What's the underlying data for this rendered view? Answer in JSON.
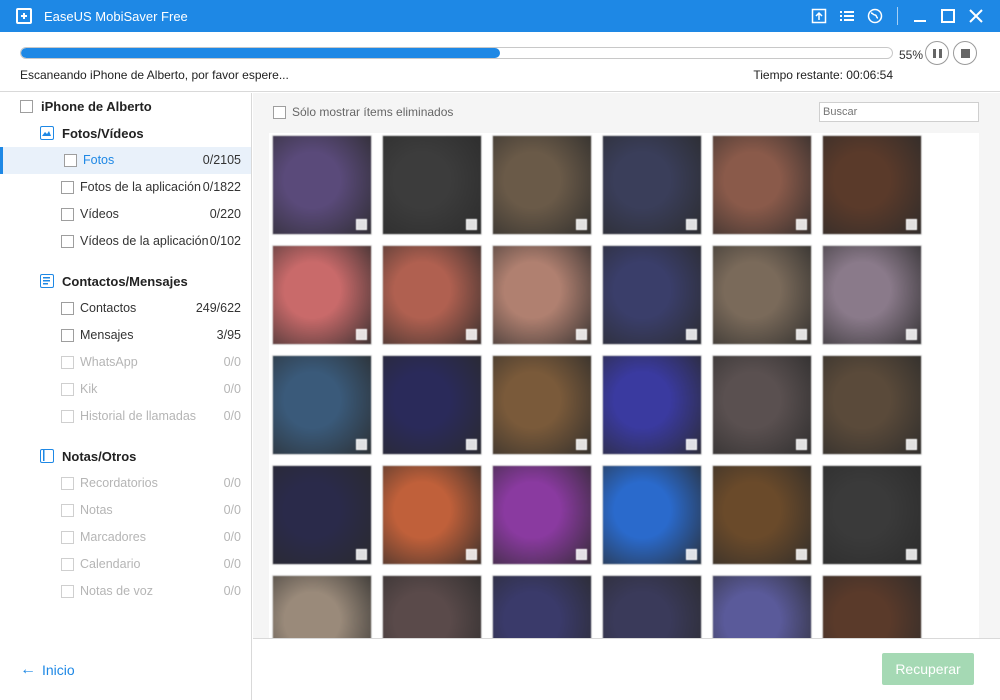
{
  "window": {
    "title": "EaseUS MobiSaver Free",
    "icons": [
      "upload-icon",
      "list-icon",
      "globe-icon",
      "minimize-icon",
      "maximize-icon",
      "close-icon"
    ]
  },
  "progress": {
    "percent_label": "55%",
    "percent": 55,
    "status": "Escaneando iPhone de Alberto, por favor espere...",
    "time_remaining": "Tiempo restante: 00:06:54"
  },
  "sidebar": {
    "device": "iPhone de Alberto",
    "categories": [
      {
        "label": "Fotos/Vídeos",
        "icon": "image-icon",
        "items": [
          {
            "label": "Fotos",
            "count": "0/2105",
            "state": "selected"
          },
          {
            "label": "Fotos de la aplicación",
            "count": "0/1822",
            "state": "normal"
          },
          {
            "label": "Vídeos",
            "count": "0/220",
            "state": "normal"
          },
          {
            "label": "Vídeos de la aplicación",
            "count": "0/102",
            "state": "normal"
          }
        ]
      },
      {
        "label": "Contactos/Mensajes",
        "icon": "contacts-icon",
        "items": [
          {
            "label": "Contactos",
            "count": "249/622",
            "state": "normal"
          },
          {
            "label": "Mensajes",
            "count": "3/95",
            "state": "normal"
          },
          {
            "label": "WhatsApp",
            "count": "0/0",
            "state": "disabled"
          },
          {
            "label": "Kik",
            "count": "0/0",
            "state": "disabled"
          },
          {
            "label": "Historial de llamadas",
            "count": "0/0",
            "state": "disabled"
          }
        ]
      },
      {
        "label": "Notas/Otros",
        "icon": "notes-icon",
        "items": [
          {
            "label": "Recordatorios",
            "count": "0/0",
            "state": "disabled"
          },
          {
            "label": "Notas",
            "count": "0/0",
            "state": "disabled"
          },
          {
            "label": "Marcadores",
            "count": "0/0",
            "state": "disabled"
          },
          {
            "label": "Calendario",
            "count": "0/0",
            "state": "disabled"
          },
          {
            "label": "Notas de voz",
            "count": "0/0",
            "state": "disabled"
          }
        ]
      }
    ],
    "home_label": "Inicio"
  },
  "main": {
    "filter_label": "Sólo mostrar ítems eliminados",
    "search_placeholder": "Buscar",
    "thumbnail_colors": [
      "#5a4a7a",
      "#3c3c3c",
      "#6a5a48",
      "#3a3e5a",
      "#8a5a4a",
      "#5a3a2a",
      "#c96a6a",
      "#b06050",
      "#b08070",
      "#3a3e6a",
      "#7a6a5a",
      "#8a7a8a",
      "#3a5a7a",
      "#2a2a5a",
      "#7a5a3a",
      "#3a3aa0",
      "#5a5050",
      "#5a4a3a",
      "#2a2a4a",
      "#c0603a",
      "#8a3aa0",
      "#2a6acc",
      "#6a4a2a",
      "#3a3a3a",
      "#9a8a7a",
      "#5a4a4a",
      "#3a3a6a",
      "#3a3a5a",
      "#5a5a9a",
      "#5a3a2a"
    ]
  },
  "footer": {
    "recover_label": "Recuperar",
    "recover_color": "#a5d9b4"
  },
  "accent": "#1e88e5"
}
